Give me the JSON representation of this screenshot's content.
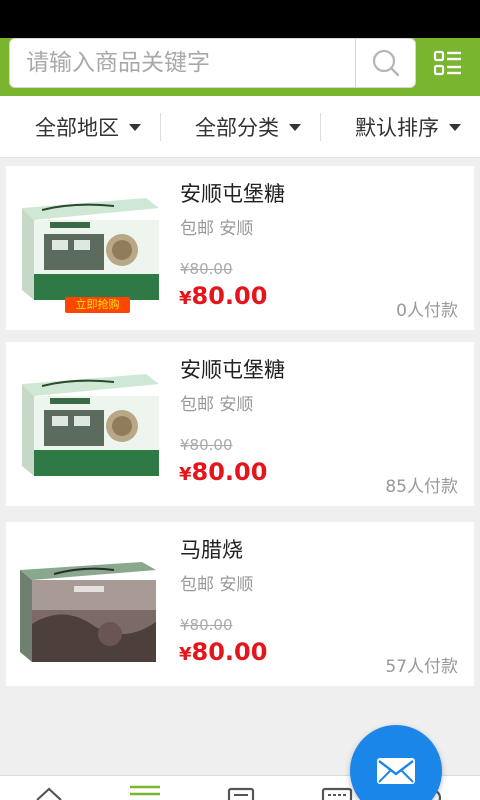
{
  "search": {
    "placeholder": "请输入商品关键字",
    "search_icon": "search-icon",
    "menu_icon": "list-menu-icon"
  },
  "filters": [
    {
      "label": "全部地区",
      "icon": "caret-down-icon"
    },
    {
      "label": "全部分类",
      "icon": "caret-down-icon"
    },
    {
      "label": "默认排序",
      "icon": "caret-down-icon"
    }
  ],
  "products": [
    {
      "title": "安顺屯堡糖",
      "tags": "包邮 安顺",
      "old_price": "¥80.00",
      "currency": "¥",
      "price": "80.00",
      "sold": "0人付款",
      "badge": "立即抢购"
    },
    {
      "title": "安顺屯堡糖",
      "tags": "包邮 安顺",
      "old_price": "¥80.00",
      "currency": "¥",
      "price": "80.00",
      "sold": "85人付款"
    },
    {
      "title": "马腊烧",
      "tags": "包邮 安顺",
      "old_price": "¥80.00",
      "currency": "¥",
      "price": "80.00",
      "sold": "57人付款"
    }
  ],
  "tabbar": {
    "tabs": [
      "home-icon",
      "list-icon",
      "news-icon",
      "keyboard-icon",
      "user-icon"
    ]
  },
  "fab": {
    "icon": "mail-icon"
  },
  "colors": {
    "brand_green": "#7ab530",
    "price_red": "#e4161c",
    "fab_blue": "#1a86e8"
  }
}
